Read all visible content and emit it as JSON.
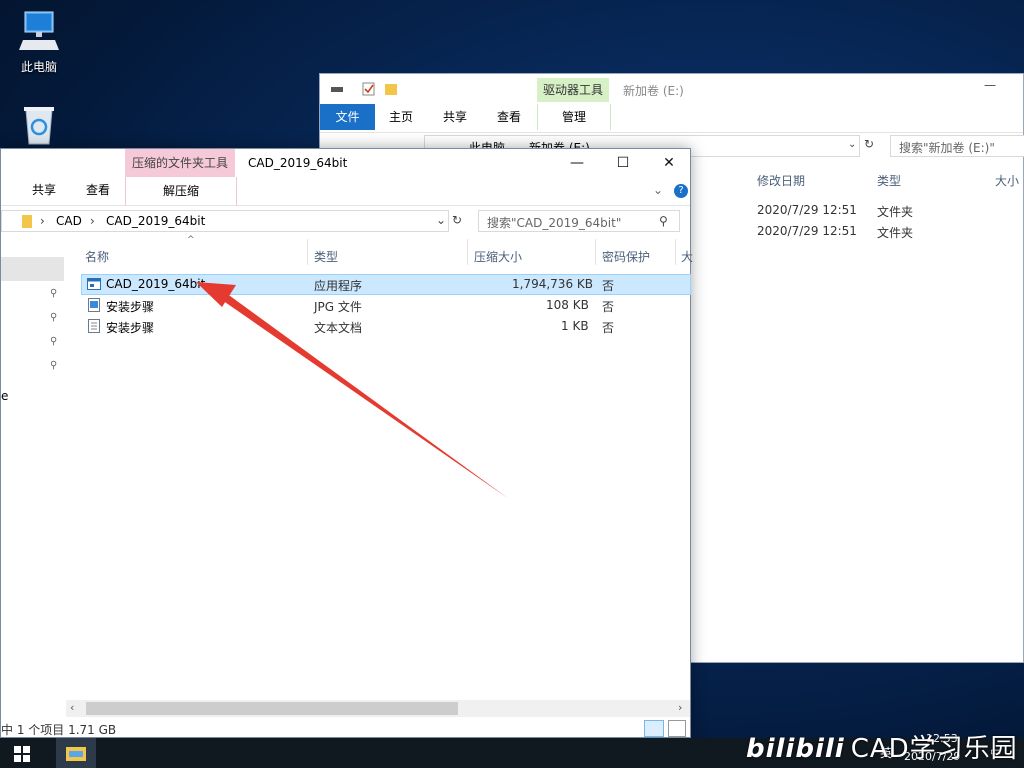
{
  "desktop": {
    "icons": [
      {
        "label": "此电脑",
        "icon": "computer-icon"
      },
      {
        "label": "",
        "icon": "recycle-bin-icon"
      }
    ]
  },
  "back_window": {
    "title": "新加卷 (E:)",
    "context_tab_group": "驱动器工具",
    "context_tab": "管理",
    "tabs": [
      "文件",
      "主页",
      "共享",
      "查看"
    ],
    "breadcrumb": [
      "此电脑",
      "新加卷 (E:)"
    ],
    "search_placeholder": "搜索\"新加卷 (E:)\"",
    "columns": [
      "修改日期",
      "类型",
      "大小"
    ],
    "rows": [
      {
        "date": "2020/7/29 12:51",
        "type": "文件夹"
      },
      {
        "date": "2020/7/29 12:51",
        "type": "文件夹"
      }
    ]
  },
  "front_window": {
    "title": "CAD_2019_64bit",
    "context_tab_group": "压缩的文件夹工具",
    "context_tab": "解压缩",
    "tabs": [
      "共享",
      "查看"
    ],
    "breadcrumb": [
      "CAD",
      "CAD_2019_64bit"
    ],
    "search_placeholder": "搜索\"CAD_2019_64bit\"",
    "columns": [
      "名称",
      "类型",
      "压缩大小",
      "密码保护",
      "大"
    ],
    "files": [
      {
        "name": "CAD_2019_64bit",
        "type": "应用程序",
        "size": "1,794,736 KB",
        "protected": "否",
        "icon": "application-icon",
        "selected": true
      },
      {
        "name": "安装步骤",
        "type": "JPG 文件",
        "size": "108 KB",
        "protected": "否",
        "icon": "image-file-icon",
        "selected": false
      },
      {
        "name": "安装步骤",
        "type": "文本文档",
        "size": "1 KB",
        "protected": "否",
        "icon": "text-file-icon",
        "selected": false
      }
    ],
    "nav_fragment": "e",
    "status": "中 1 个项目  1.71 GB"
  },
  "taskbar": {
    "clock_time": "12:53",
    "clock_date": "2020/7/29",
    "lang": "英"
  },
  "watermark": "CAD学习乐园",
  "colors": {
    "accent": "#1a6fc7",
    "selection": "#cce8ff",
    "arrow": "#e53a2f"
  }
}
